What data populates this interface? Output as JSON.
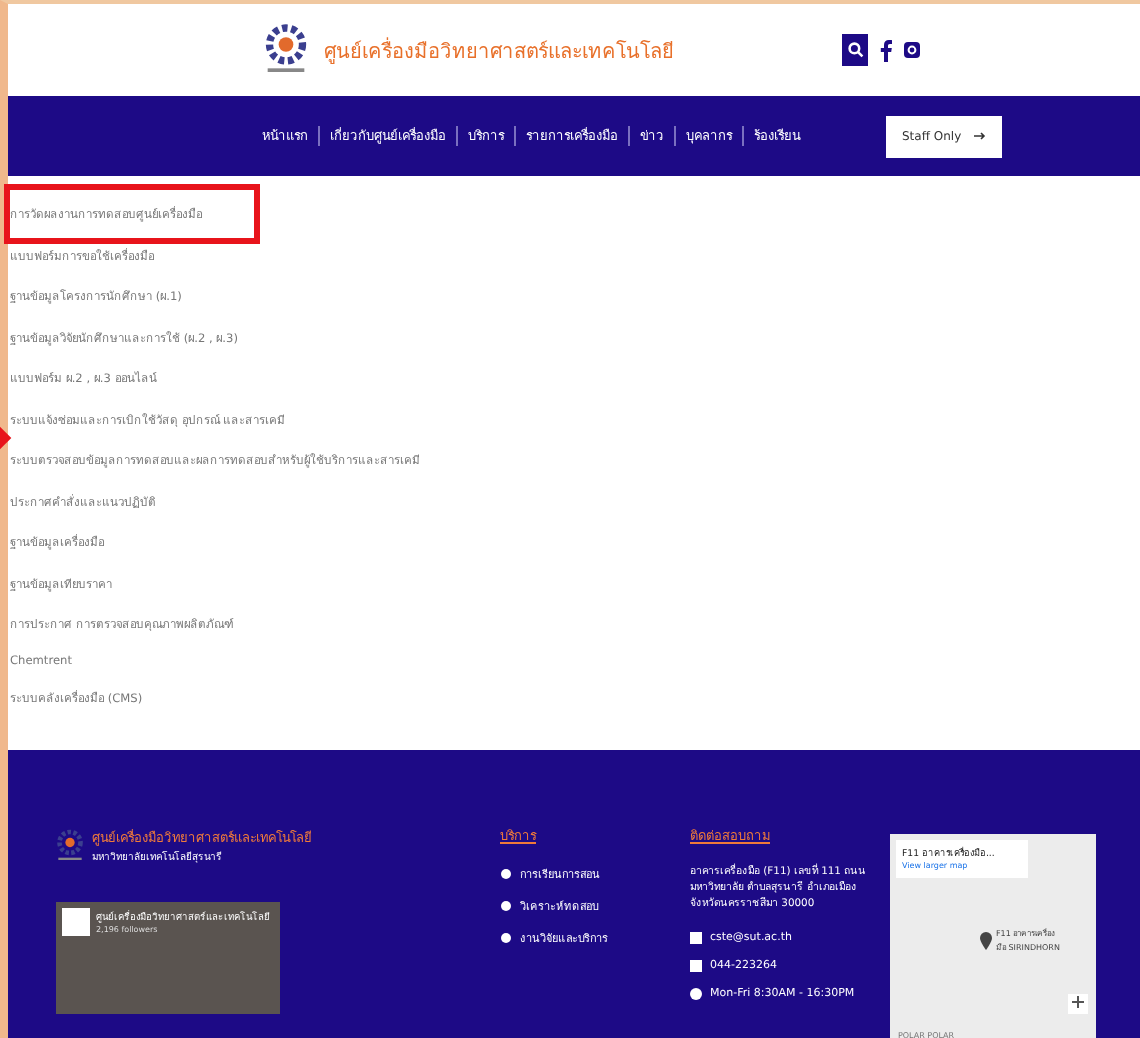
{
  "header": {
    "title": "ศูนย์เครื่องมือวิทยาศาสตร์และเทคโนโลยี"
  },
  "nav": {
    "items": [
      {
        "label": "หน้าแรก"
      },
      {
        "label": "เกี่ยวกับศูนย์เครื่องมือ"
      },
      {
        "label": "บริการ"
      },
      {
        "label": "รายการเครื่องมือ"
      },
      {
        "label": "ข่าว"
      },
      {
        "label": "บุคลากร"
      },
      {
        "label": "ร้องเรียน"
      }
    ],
    "staff_button": "Staff Only"
  },
  "links": [
    {
      "label": "การวัดผลงานการทดสอบศูนย์เครื่องมือ",
      "highlighted": true
    },
    {
      "label": "แบบฟอร์มการขอใช้เครื่องมือ",
      "highlighted": false
    },
    {
      "label": "ฐานข้อมูลโครงการนักศึกษา (ผ.1)",
      "highlighted": false
    },
    {
      "label": "ฐานข้อมูลวิจัยนักศึกษาและการใช้ (ผ.2 , ผ.3)",
      "highlighted": false
    },
    {
      "label": "แบบฟอร์ม ผ.2 , ผ.3 ออนไลน์",
      "highlighted": false
    },
    {
      "label": "ระบบแจ้งซ่อมและการเบิกใช้วัสดุ อุปกรณ์ และสารเคมี",
      "highlighted": false
    },
    {
      "label": "ระบบตรวจสอบข้อมูลการทดสอบและผลการทดสอบสำหรับผู้ใช้บริการและสารเคมี",
      "highlighted": false
    },
    {
      "label": "ประกาศคำสั่งและแนวปฏิบัติ",
      "highlighted": false
    },
    {
      "label": "ฐานข้อมูลเครื่องมือ",
      "highlighted": false
    },
    {
      "label": "ฐานข้อมูลเทียบราคา",
      "highlighted": false
    },
    {
      "label": "การประกาศ การตรวจสอบคุณภาพผลิตภัณฑ์",
      "highlighted": false
    },
    {
      "label": "Chemtrent",
      "highlighted": false
    },
    {
      "label": "ระบบคลังเครื่องมือ (CMS)",
      "highlighted": false
    }
  ],
  "footer": {
    "title": "ศูนย์เครื่องมือวิทยาศาสตร์และเทคโนโลยี",
    "subtitle": "มหาวิทยาลัยเทคโนโลยีสุรนารี",
    "facebook_page": {
      "name": "ศูนย์เครื่องมือวิทยาศาสตร์และเทคโนโลยี",
      "followers": "2,196 followers"
    },
    "services": {
      "heading": "บริการ",
      "items": [
        "การเรียนการสอน",
        "วิเคราะห์ทดสอบ",
        "งานวิจัยและบริการ"
      ]
    },
    "contact": {
      "heading": "ติดต่อสอบถาม",
      "address": "อาคารเครื่องมือ (F11) เลขที่ 111 ถนนมหาวิทยาลัย ตำบลสุรนารี อำเภอเมือง จังหวัดนครราชสีมา 30000",
      "email": "cste@sut.ac.th",
      "phone": "044-223264",
      "hours": "Mon-Fri 8:30AM - 16:30PM"
    },
    "map": {
      "place": "F11 อาคารเครื่องมือ...",
      "link": "View larger map",
      "pin_label": "F11 อาคารเครื่องมือ SIRINDHORN",
      "attribution": "POLAR POLAR"
    }
  }
}
